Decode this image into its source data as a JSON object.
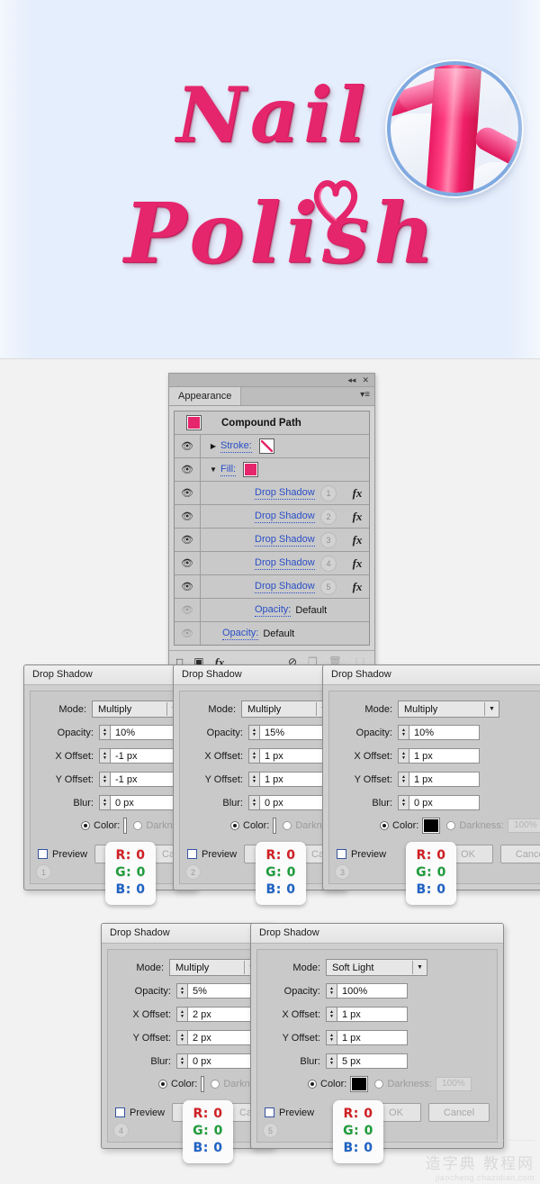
{
  "artwork": {
    "background_color": "#e5eefc",
    "word_top": "Nail",
    "word_bottom": "Polish",
    "accent_color": "#e5266c",
    "magnifier_ring_color": "#7fa9e0",
    "heart_label": "heart-decoration"
  },
  "appearance_panel": {
    "tab_label": "Appearance",
    "collapse_icon": "◂◂",
    "close_icon": "✕",
    "menu_icon": "▾≡",
    "object_title": "Compound Path",
    "rows": [
      {
        "type": "object",
        "label": "Compound Path",
        "swatch": "fill"
      },
      {
        "type": "attr",
        "label": "Stroke:",
        "triangle": "▶",
        "swatch": "none",
        "eye": true
      },
      {
        "type": "attr",
        "label": "Fill:",
        "triangle": "▼",
        "swatch": "fill",
        "eye": true
      },
      {
        "type": "effect",
        "label": "Drop Shadow",
        "number": "1",
        "fx": "fx",
        "eye": true
      },
      {
        "type": "effect",
        "label": "Drop Shadow",
        "number": "2",
        "fx": "fx",
        "eye": true
      },
      {
        "type": "effect",
        "label": "Drop Shadow",
        "number": "3",
        "fx": "fx",
        "eye": true
      },
      {
        "type": "effect",
        "label": "Drop Shadow",
        "number": "4",
        "fx": "fx",
        "eye": true
      },
      {
        "type": "effect",
        "label": "Drop Shadow",
        "number": "5",
        "fx": "fx",
        "eye": true
      },
      {
        "type": "opacity",
        "label": "Opacity:",
        "value": "Default",
        "eye": false,
        "indent": 0
      },
      {
        "type": "opacity",
        "label": "Opacity:",
        "value": "Default",
        "eye": false,
        "indent": 1
      }
    ],
    "footer_icons": [
      {
        "name": "add-new-stroke-icon",
        "glyph": "□"
      },
      {
        "name": "add-new-fill-icon",
        "glyph": "▣"
      },
      {
        "name": "add-new-effect-icon",
        "glyph": "fx"
      },
      {
        "name": "clear-appearance-icon",
        "glyph": "⊘"
      },
      {
        "name": "duplicate-item-icon",
        "glyph": "❐"
      },
      {
        "name": "delete-item-icon",
        "glyph": "Ὕ1"
      }
    ]
  },
  "dialog_common": {
    "title": "Drop Shadow",
    "labels": {
      "mode": "Mode:",
      "opacity": "Opacity:",
      "x_offset": "X Offset:",
      "y_offset": "Y Offset:",
      "blur": "Blur:",
      "color": "Color:",
      "darkness": "Darkness:",
      "preview": "Preview"
    },
    "darkness_value": "100%",
    "ok_label": "OK",
    "cancel_label": "Cancel",
    "rgb_card": {
      "r": "R: 0",
      "g": "G: 0",
      "b": "B: 0"
    },
    "color_swatch_hex": "#000000"
  },
  "dialogs": [
    {
      "step": "1",
      "mode": "Multiply",
      "opacity": "10%",
      "x_offset": "-1 px",
      "y_offset": "-1 px",
      "blur": "0 px"
    },
    {
      "step": "2",
      "mode": "Multiply",
      "opacity": "15%",
      "x_offset": "1 px",
      "y_offset": "1 px",
      "blur": "0 px"
    },
    {
      "step": "3",
      "mode": "Multiply",
      "opacity": "10%",
      "x_offset": "1 px",
      "y_offset": "1 px",
      "blur": "0 px"
    },
    {
      "step": "4",
      "mode": "Multiply",
      "opacity": "5%",
      "x_offset": "2 px",
      "y_offset": "2 px",
      "blur": "0 px"
    },
    {
      "step": "5",
      "mode": "Soft Light",
      "opacity": "100%",
      "x_offset": "1 px",
      "y_offset": "1 px",
      "blur": "5 px"
    }
  ],
  "watermark": {
    "cn": "造字典 教程网",
    "url": "jiaocheng.chazidian.com"
  }
}
